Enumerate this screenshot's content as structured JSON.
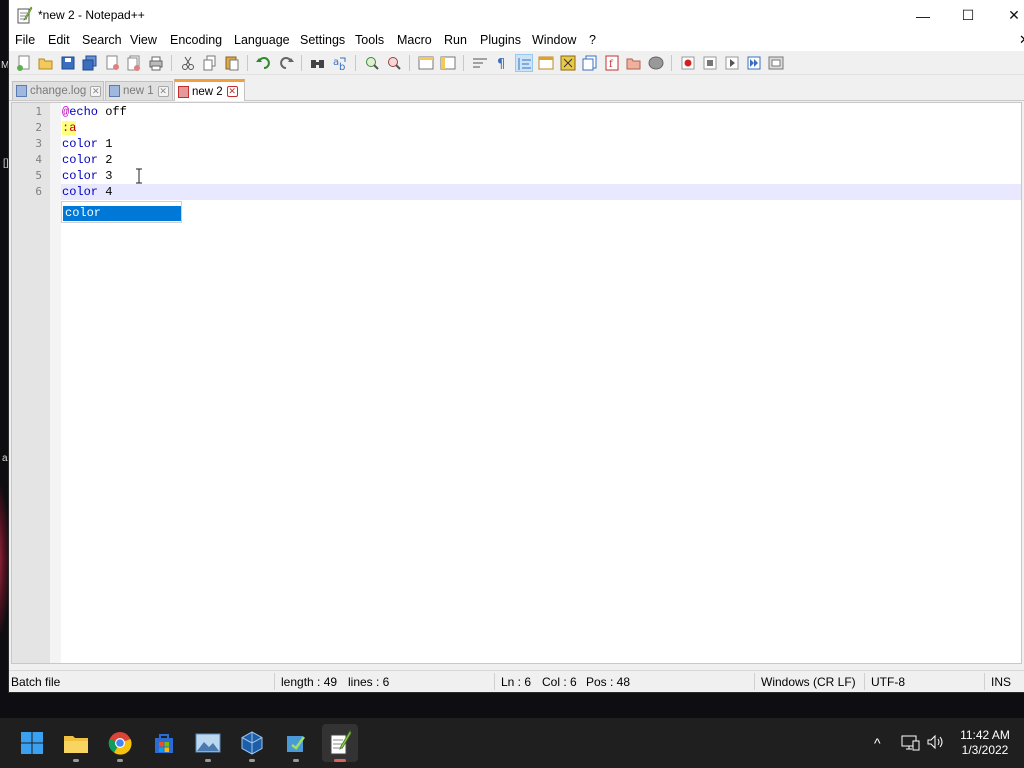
{
  "window": {
    "title": "*new 2 - Notepad++",
    "min_glyph": "—",
    "max_glyph": "☐",
    "close_glyph": "✕"
  },
  "menu": {
    "items": [
      "File",
      "Edit",
      "Search",
      "View",
      "Encoding",
      "Language",
      "Settings",
      "Tools",
      "Macro",
      "Run",
      "Plugins",
      "Window",
      "?"
    ],
    "close_glyph": "✕"
  },
  "tabs": [
    {
      "label": "change.log",
      "active": false,
      "close": "✕"
    },
    {
      "label": "new 1",
      "active": false,
      "close": "✕"
    },
    {
      "label": "new 2",
      "active": true,
      "close": "✕"
    }
  ],
  "editor": {
    "line_numbers": [
      "1",
      "2",
      "3",
      "4",
      "5",
      "6"
    ],
    "lines": [
      {
        "parts": [
          {
            "t": "@",
            "c": "at"
          },
          {
            "t": "echo",
            "c": "kw"
          },
          {
            "t": " off",
            "c": "plain"
          }
        ]
      },
      {
        "parts": [
          {
            "t": ":a",
            "c": "label-hl"
          }
        ]
      },
      {
        "parts": [
          {
            "t": "color",
            "c": "kw"
          },
          {
            "t": " 1",
            "c": "plain"
          }
        ]
      },
      {
        "parts": [
          {
            "t": "color",
            "c": "kw"
          },
          {
            "t": " 2",
            "c": "plain"
          }
        ]
      },
      {
        "parts": [
          {
            "t": "color",
            "c": "kw"
          },
          {
            "t": " 3",
            "c": "plain"
          }
        ]
      },
      {
        "parts": [
          {
            "t": "color",
            "c": "kw"
          },
          {
            "t": " 4",
            "c": "plain"
          }
        ]
      }
    ],
    "current_line": 6,
    "autocomplete_item": "color"
  },
  "status": {
    "language": "Batch file",
    "length": "length : 49",
    "lines": "lines : 6",
    "ln": "Ln : 6",
    "col": "Col : 6",
    "pos": "Pos : 48",
    "eol": "Windows (CR LF)",
    "encoding": "UTF-8",
    "mode": "INS"
  },
  "taskbar": {
    "apps": [
      "start-icon",
      "file-explorer-icon",
      "chrome-icon",
      "microsoft-store-icon",
      "photos-icon",
      "virtualbox-icon",
      "notepad-icon",
      "notepadpp-icon"
    ],
    "tray_chevron": "^",
    "time": "11:42 AM",
    "date": "1/3/2022"
  },
  "desktop": {
    "letter_m": "M",
    "letter_a": "a",
    "bracket": "[]"
  },
  "colors": {
    "keyword": "#0000c0",
    "at_sign": "#c000c0",
    "label_bg": "#ffff80",
    "label_fg": "#c00000",
    "current_line": "#e8e8ff",
    "autocomplete_bg": "#0078d7",
    "active_tab_accent": "#f0a040"
  }
}
